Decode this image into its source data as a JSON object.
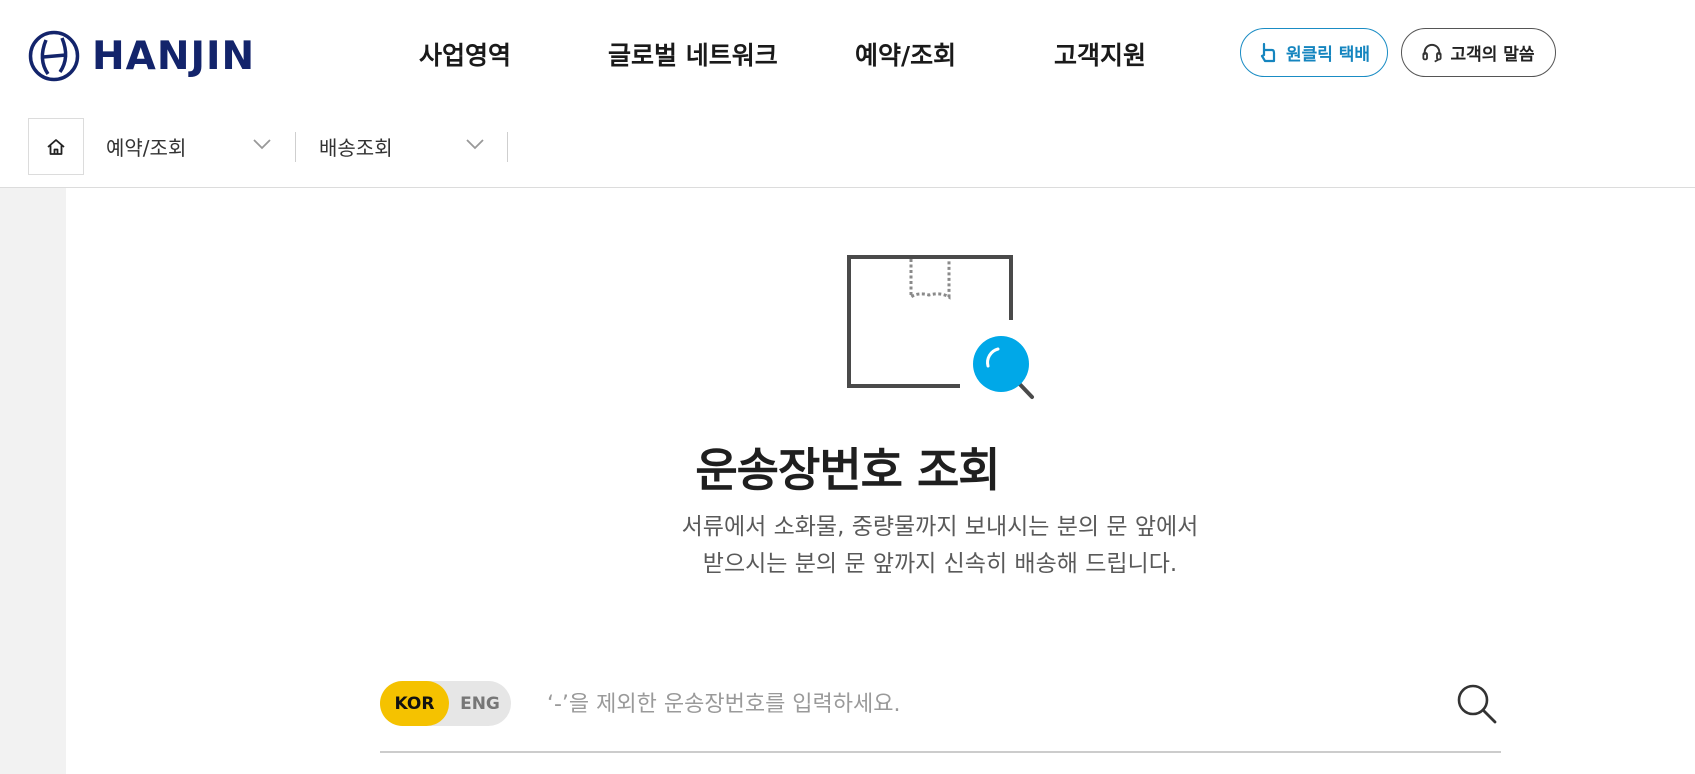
{
  "logo": {
    "text": "HANJIN"
  },
  "nav": {
    "items": [
      {
        "label": "사업영역"
      },
      {
        "label": "글로벌 네트워크"
      },
      {
        "label": "예약/조회"
      },
      {
        "label": "고객지원"
      }
    ],
    "active_index": 2
  },
  "quick_buttons": {
    "one_click": "원클릭 택배",
    "customer_voice": "고객의 말씀"
  },
  "breadcrumb": {
    "level1": "예약/조회",
    "level2": "배송조회"
  },
  "main": {
    "title": "운송장번호 조회",
    "desc_line1": "서류에서 소화물, 중량물까지 보내시는 분의 문 앞에서",
    "desc_line2": "받으시는 분의 문 앞까지 신속히 배송해 드립니다."
  },
  "search": {
    "lang_kor": "KOR",
    "lang_eng": "ENG",
    "placeholder": "‘-’을 제외한 운송장번호를 입력하세요.",
    "value": ""
  },
  "colors": {
    "brand_navy": "#13246b",
    "accent_blue": "#1ba3dd",
    "kor_yellow": "#f5c200"
  },
  "icons": {
    "logo_mark": "hanjin-logo-icon",
    "one_click": "pointing-hand-icon",
    "customer_voice": "headset-icon",
    "home": "home-icon",
    "chevron": "chevron-down-icon",
    "hero": "box-search-icon",
    "search": "search-icon"
  }
}
